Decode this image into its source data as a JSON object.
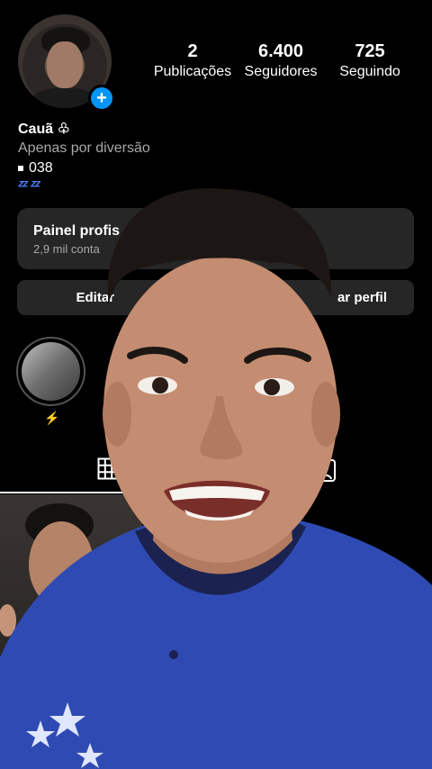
{
  "profile": {
    "name": "Cauã ♧",
    "bio_line1": "Apenas por diversão",
    "bio_line2": "038",
    "bio_emoji": "ᶻᶻ ᶻᶻ"
  },
  "stats": [
    {
      "value": "2",
      "label": "Publicações"
    },
    {
      "value": "6.400",
      "label": "Seguidores"
    },
    {
      "value": "725",
      "label": "Seguindo"
    }
  ],
  "panel": {
    "title": "Painel profis",
    "subtitle": "2,9 mil conta"
  },
  "buttons": {
    "edit": "Editar",
    "share": "ar perfil"
  },
  "highlight": {
    "icon": "⚡"
  },
  "icons": {
    "add": "plus-icon",
    "grid": "grid-icon",
    "tagged": "tagged-user-icon"
  },
  "colors": {
    "accent": "#0095f6",
    "background": "#000000",
    "card": "#262626",
    "shirt": "#2f4bb3"
  }
}
